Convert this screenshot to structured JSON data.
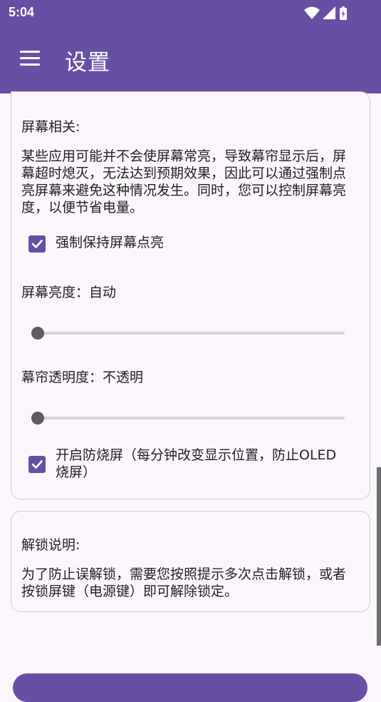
{
  "status": {
    "time": "5:04"
  },
  "appbar": {
    "title": "设置"
  },
  "screen_section": {
    "title": "屏幕相关:",
    "description": "某些应用可能并不会使屏幕常亮，导致幕帘显示后，屏幕超时熄灭，无法达到预期效果，因此可以通过强制点亮屏幕来避免这种情况发生。同时，您可以控制屏幕亮度，以便节省电量。",
    "keep_screen_on": {
      "label": "强制保持屏幕点亮",
      "checked": true
    },
    "brightness": {
      "label": "屏幕亮度：自动",
      "value": 0
    },
    "curtain_opacity": {
      "label": "幕帘透明度：不透明",
      "value": 0
    },
    "burn_in": {
      "label": "开启防烧屏（每分钟改变显示位置，防止OLED烧屏）",
      "checked": true
    }
  },
  "unlock_section": {
    "title": "解锁说明:",
    "description": "为了防止误解锁，需要您按照提示多次点击解锁，或者按锁屏键（电源键）即可解除锁定。"
  },
  "colors": {
    "primary": "#6750a4",
    "slider_track": "#d5d0da",
    "slider_thumb": "#5f5b66"
  }
}
